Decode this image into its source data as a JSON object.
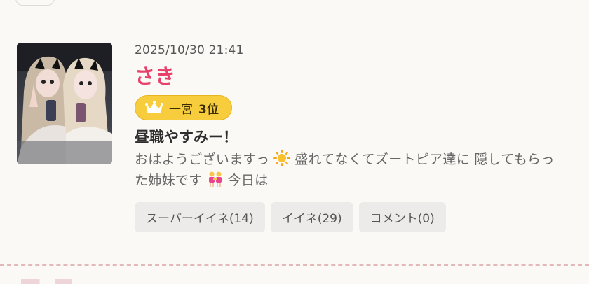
{
  "post": {
    "date": "2025/10/30 21:41",
    "name": "さき",
    "rank": {
      "place": "一宮",
      "position": "3位"
    },
    "title": "昼職やすみー！",
    "body": {
      "part1": "おはようございますっ",
      "emoji1": "sun-emoji",
      "part2": "盛れてなくてズートピア達に 隠してもらった姉妹です",
      "emoji2": "two-women-emoji",
      "part3": "今日は"
    },
    "actions": {
      "super_like": "スーパーイイネ(14)",
      "like": "イイネ(29)",
      "comment": "コメント(0)"
    }
  },
  "colors": {
    "name": "#e7406b",
    "badge": "#f8cd3d",
    "background": "#fbf9f6"
  }
}
